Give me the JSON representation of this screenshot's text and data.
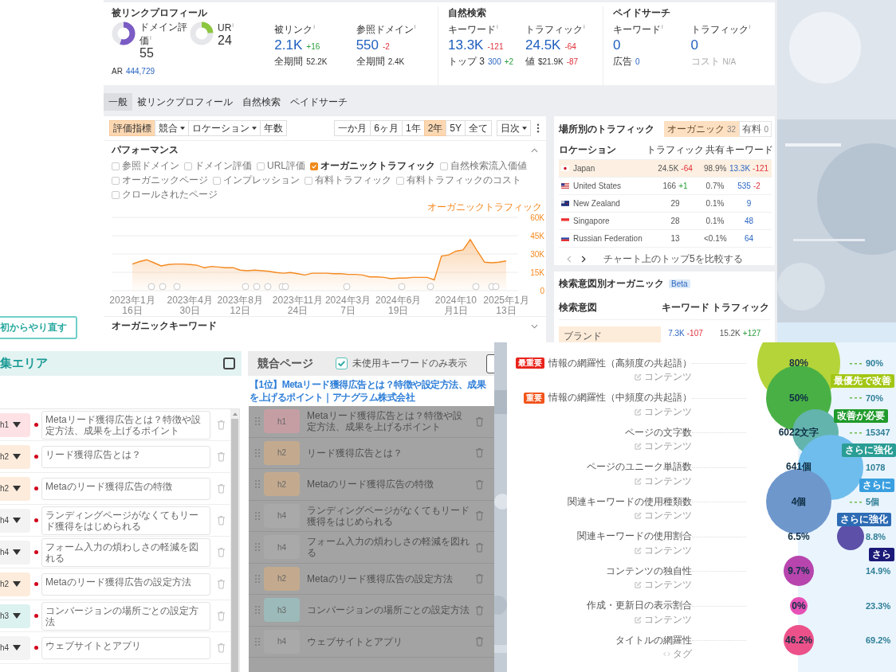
{
  "dashboard": {
    "summary": {
      "backlink": {
        "title": "被リンクプロフィール",
        "ratings": [
          {
            "label": "ドメイン評価",
            "info": "i",
            "value": "55",
            "level": 0.55,
            "color": "#7b5bc4"
          },
          {
            "label": "UR",
            "info": "i",
            "value": "24",
            "level": 0.24,
            "color": "#8cc63f"
          }
        ],
        "ar": {
          "label": "AR",
          "value": "444,729"
        },
        "stats": [
          {
            "label": "被リンク",
            "info": "i",
            "value": "2.1K",
            "change": {
              "text": "+16",
              "kind": "up"
            },
            "details": [
              {
                "text": "全期間",
                "kind": "plain"
              },
              {
                "text": "52.2K",
                "kind": "plain"
              }
            ]
          },
          {
            "label": "参照ドメイン",
            "info": "i",
            "value": "550",
            "change": {
              "text": "-2",
              "kind": "down"
            },
            "details": [
              {
                "text": "全期間",
                "kind": "plain"
              },
              {
                "text": "2.4K",
                "kind": "plain"
              }
            ]
          }
        ]
      },
      "sections": [
        {
          "title": "自然検索",
          "stats": [
            {
              "label": "キーワード",
              "info": "i",
              "value": "13.3K",
              "change": {
                "text": "-121",
                "kind": "down"
              },
              "details": [
                {
                  "text": "トップ 3",
                  "kind": "plain"
                },
                {
                  "text": "300",
                  "kind": "link"
                },
                {
                  "text": "+2",
                  "kind": "up"
                }
              ]
            },
            {
              "label": "トラフィック",
              "info": "i",
              "value": "24.5K",
              "change": {
                "text": "-64",
                "kind": "down"
              },
              "details": [
                {
                  "text": "値",
                  "kind": "plain"
                },
                {
                  "text": "$21.9K",
                  "kind": "plain"
                },
                {
                  "text": "-87",
                  "kind": "down"
                }
              ]
            }
          ]
        },
        {
          "title": "ペイドサーチ",
          "stats": [
            {
              "label": "キーワード",
              "info": "i",
              "value": "0",
              "details": [
                {
                  "text": "広告",
                  "kind": "plain"
                },
                {
                  "text": "0",
                  "kind": "link"
                }
              ]
            },
            {
              "label": "トラフィック",
              "info": "i",
              "value": "0",
              "details": [
                {
                  "text": "コスト",
                  "kind": "muted"
                },
                {
                  "text": "N/A",
                  "kind": "muted"
                }
              ]
            }
          ]
        }
      ]
    },
    "tabs": [
      {
        "label": "一般",
        "selected": true
      },
      {
        "label": "被リンクプロフィール",
        "selected": false
      },
      {
        "label": "自然検索",
        "selected": false
      },
      {
        "label": "ペイドサーチ",
        "selected": false
      }
    ],
    "toolbar": {
      "filters": [
        {
          "label": "評価指標",
          "selected": true,
          "dropdown": false
        },
        {
          "label": "競合",
          "selected": false,
          "dropdown": true
        },
        {
          "label": "ロケーション",
          "selected": false,
          "dropdown": true
        },
        {
          "label": "年数",
          "selected": false,
          "dropdown": false
        }
      ],
      "ranges": [
        {
          "label": "一か月",
          "selected": false
        },
        {
          "label": "6ヶ月",
          "selected": false
        },
        {
          "label": "1年",
          "selected": false
        },
        {
          "label": "2年",
          "selected": true
        },
        {
          "label": "5Y",
          "selected": false
        },
        {
          "label": "全て",
          "selected": false
        }
      ],
      "interval": {
        "label": "日次"
      }
    },
    "performance": {
      "title": "パフォーマンス",
      "expanded": true,
      "metrics": [
        {
          "label": "参照ドメイン",
          "checked": false
        },
        {
          "label": "ドメイン評価",
          "checked": false
        },
        {
          "label": "URL評価",
          "checked": false
        },
        {
          "label": "オーガニックトラフィック",
          "checked": true
        },
        {
          "label": "自然検索流入価値",
          "checked": false
        },
        {
          "label": "オーガニックページ",
          "checked": false
        },
        {
          "label": "インプレッション",
          "checked": false
        },
        {
          "label": "有料トラフィック",
          "checked": false
        },
        {
          "label": "有料トラフィックのコスト",
          "checked": false
        },
        {
          "label": "クロールされたページ",
          "checked": false
        }
      ],
      "chart_data": {
        "type": "area",
        "categories": [
          "2023年1月16日",
          null,
          null,
          null,
          null,
          null,
          null,
          null,
          "2023年4月30日",
          null,
          null,
          null,
          null,
          null,
          null,
          "2023年8月12日",
          null,
          null,
          null,
          null,
          null,
          null,
          null,
          "2023年11月24日",
          null,
          null,
          null,
          null,
          null,
          null,
          "2024年3月7日",
          null,
          null,
          null,
          null,
          null,
          null,
          "2024年6月19日",
          null,
          null,
          null,
          null,
          null,
          null,
          null,
          "2024年10月1日",
          null,
          null,
          null,
          null,
          null,
          null,
          "2025年1月13日"
        ],
        "series": [
          {
            "name": "オーガニックトラフィック",
            "color": "#f5891f",
            "values": [
              21800,
              23800,
              25300,
              22800,
              20300,
              21300,
              21800,
              21800,
              21300,
              20800,
              18800,
              19800,
              19300,
              18800,
              18800,
              16800,
              16300,
              16800,
              16300,
              15800,
              14800,
              14300,
              14800,
              13800,
              12800,
              14300,
              14300,
              14300,
              13800,
              13800,
              13300,
              13300,
              12800,
              11300,
              11300,
              10800,
              9800,
              10300,
              10300,
              10800,
              10800,
              10800,
              8800,
              28300,
              29300,
              32300,
              33300,
              41800,
              32300,
              23300,
              22800,
              23300,
              24300
            ]
          }
        ],
        "ylim": [
          0,
          60000
        ],
        "grid": true,
        "yticks": [
          {
            "value": 0,
            "label": "0"
          },
          {
            "value": 15000,
            "label": "15K"
          },
          {
            "value": 30000,
            "label": "30K"
          },
          {
            "value": 45000,
            "label": "45K"
          },
          {
            "value": 60000,
            "label": "60K"
          }
        ]
      }
    },
    "keywords_section": {
      "title": "オーガニックキーワード",
      "expanded": false
    },
    "locations": {
      "title": "場所別のトラフィック",
      "toggle": [
        {
          "label": "オーガニック",
          "count": "32",
          "selected": true
        },
        {
          "label": "有料",
          "count": "0",
          "selected": false
        }
      ],
      "columns": [
        "ロケーション",
        "トラフィック",
        "共有",
        "キーワード"
      ],
      "rows": [
        {
          "kind": "jp",
          "name": "Japan",
          "traffic": "24.5K",
          "traffic_change": {
            "text": "-64",
            "kind": "down"
          },
          "share": "98.9%",
          "keywords": "13.3K",
          "keywords_change": {
            "text": "-121",
            "kind": "down"
          },
          "selected": true
        },
        {
          "kind": "us",
          "name": "United States",
          "traffic": "166",
          "traffic_change": {
            "text": "+1",
            "kind": "up"
          },
          "share": "0.7%",
          "keywords": "535",
          "keywords_change": {
            "text": "-2",
            "kind": "down"
          },
          "selected": false
        },
        {
          "kind": "nz",
          "name": "New Zealand",
          "traffic": "29",
          "share": "0.1%",
          "keywords": "9",
          "selected": false
        },
        {
          "kind": "sg",
          "name": "Singapore",
          "traffic": "28",
          "share": "0.1%",
          "keywords": "48",
          "selected": false
        },
        {
          "kind": "ru",
          "name": "Russian Federation",
          "traffic": "13",
          "share": "<0.1%",
          "keywords": "64",
          "selected": false
        }
      ],
      "pager": {
        "prev_disabled": true,
        "next_disabled": false,
        "compare": "チャート上のトップ5を比較する"
      }
    },
    "intent": {
      "title": "検索意図別オーガニック",
      "badge": "Beta",
      "columns": [
        "検索意図",
        "キーワード",
        "トラフィック"
      ],
      "rows": [
        {
          "name": "ブランド",
          "keywords": "7.3K",
          "keywords_change": {
            "text": "-107",
            "kind": "down"
          },
          "traffic": "15.2K",
          "traffic_change": {
            "text": "+127",
            "kind": "up"
          }
        }
      ]
    }
  },
  "restart_button": "初からやり直す",
  "editor": {
    "title": "集エリア",
    "select_all": false,
    "rows": [
      {
        "level": "h1",
        "text": "Metaリード獲得広告とは？特徴や設定方法、成果を上げるポイント"
      },
      {
        "level": "h2",
        "text": "リード獲得広告とは？"
      },
      {
        "level": "h2",
        "text": "Metaのリード獲得広告の特徴"
      },
      {
        "level": "h4",
        "text": "ランディングページがなくてもリード獲得をはじめられる"
      },
      {
        "level": "h4",
        "text": "フォーム入力の煩わしさの軽減を図れる"
      },
      {
        "level": "h2",
        "text": "Metaのリード獲得広告の設定方法"
      },
      {
        "level": "h3",
        "text": "コンバージョンの場所ごとの設定方法"
      },
      {
        "level": "h4",
        "text": "ウェブサイトとアプリ"
      }
    ]
  },
  "competitor": {
    "title": "競合ページ",
    "filter": {
      "label": "未使用キーワードのみ表示",
      "checked": true
    },
    "link": "【1位】Metaリード獲得広告とは？特徴や設定方法、成果を上げるポイント｜アナグラム株式会社",
    "rows": [
      {
        "level": "h1",
        "text": "Metaリード獲得広告とは？特徴や設定方法、成果を上げるポイント"
      },
      {
        "level": "h2",
        "text": "リード獲得広告とは？"
      },
      {
        "level": "h2",
        "text": "Metaのリード獲得広告の特徴"
      },
      {
        "level": "h4",
        "text": "ランディングページがなくてもリード獲得をはじめられる"
      },
      {
        "level": "h4",
        "text": "フォーム入力の煩わしさの軽減を図れる"
      },
      {
        "level": "h2",
        "text": "Metaのリード獲得広告の設定方法"
      },
      {
        "level": "h3",
        "text": "コンバージョンの場所ごとの設定方法"
      },
      {
        "level": "h4",
        "text": "ウェブサイトとアプリ"
      }
    ]
  },
  "scores": {
    "rows": [
      {
        "label": "情報の網羅性（高頻度の共起語）",
        "priority": {
          "text": "最重要",
          "color": "#e8231b"
        },
        "category": {
          "text": "コンテンツ",
          "kind": "content"
        },
        "value": "80%",
        "color": "#b4d43a",
        "guide": true,
        "target": "90%",
        "callout": {
          "text": "最優先で改善",
          "color": "#a3c614"
        }
      },
      {
        "label": "情報の網羅性（中頻度の共起語）",
        "priority": {
          "text": "重要",
          "color": "#f2541b"
        },
        "category": {
          "text": "コンテンツ",
          "kind": "content"
        },
        "value": "50%",
        "color": "#49b045",
        "guide": true,
        "target": "70%",
        "callout": {
          "text": "改善が必要",
          "color": "#1f9a2b"
        }
      },
      {
        "label": "ページの文字数",
        "category": {
          "text": "コンテンツ",
          "kind": "content"
        },
        "value": "6022文字",
        "color": "#63b4ad",
        "guide": true,
        "target": "15347",
        "callout": {
          "text": "さらに強化",
          "color": "#2a9d94"
        }
      },
      {
        "label": "ページのユニーク単語数",
        "category": {
          "text": "コンテンツ",
          "kind": "content"
        },
        "value": "641個",
        "color": "#6fbdec",
        "guide": false,
        "target": "1078",
        "callout": {
          "text": "さらに",
          "color": "#3a9fe0"
        }
      },
      {
        "label": "関連キーワードの使用種類数",
        "category": {
          "text": "コンテンツ",
          "kind": "content"
        },
        "value": "4個",
        "color": "#6e97cc",
        "guide": true,
        "target": "5個",
        "callout": {
          "text": "さらに強化",
          "color": "#2d6cb4"
        }
      },
      {
        "label": "関連キーワードの使用割合",
        "category": {
          "text": "コンテンツ",
          "kind": "content"
        },
        "value": "6.5%",
        "color": "#5d50a8",
        "guide": false,
        "target": "8.8%",
        "callout": {
          "text": "さら",
          "color": "#1b1a78"
        }
      },
      {
        "label": "コンテンツの独自性",
        "category": {
          "text": "コンテンツ",
          "kind": "content"
        },
        "value": "9.7%",
        "color": "#b745ad",
        "guide": false,
        "target": "14.9%"
      },
      {
        "label": "作成・更新日の表示割合",
        "category": {
          "text": "コンテンツ",
          "kind": "content"
        },
        "value": "0%",
        "color": "#e651b6",
        "guide": false,
        "target": "23.3%"
      },
      {
        "label": "タイトルの網羅性",
        "category": {
          "text": "タグ",
          "kind": "tag"
        },
        "value": "46.2%",
        "color": "#ec5189",
        "guide": false,
        "target": "69.2%"
      }
    ]
  }
}
